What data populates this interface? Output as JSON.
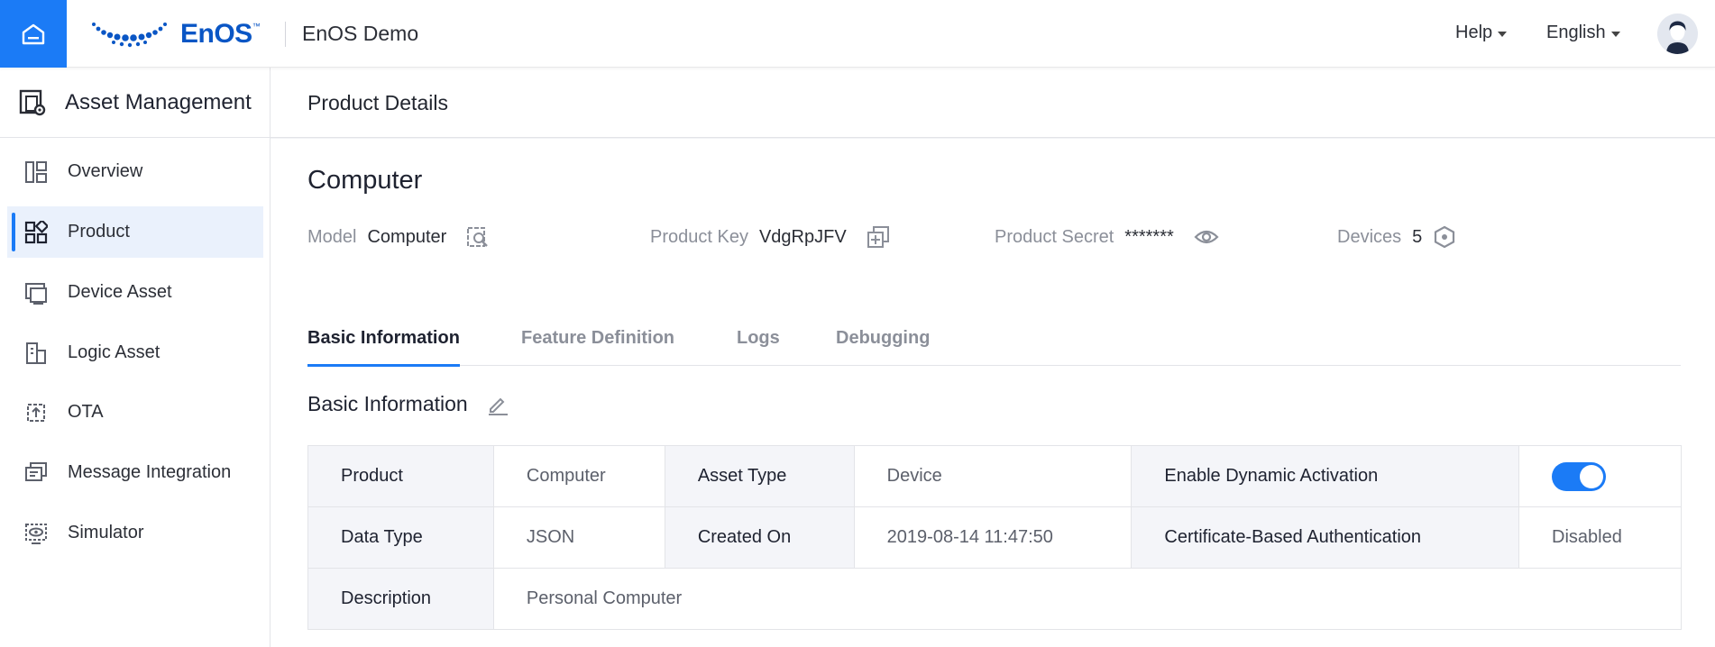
{
  "header": {
    "logo_text": "EnOS",
    "logo_tm": "™",
    "app_name": "EnOS Demo",
    "help_label": "Help",
    "language_label": "English"
  },
  "sidebar": {
    "title": "Asset Management",
    "items": [
      {
        "label": "Overview",
        "icon": "overview-icon",
        "active": false
      },
      {
        "label": "Product",
        "icon": "product-icon",
        "active": true
      },
      {
        "label": "Device Asset",
        "icon": "device-asset-icon",
        "active": false
      },
      {
        "label": "Logic Asset",
        "icon": "logic-asset-icon",
        "active": false
      },
      {
        "label": "OTA",
        "icon": "ota-icon",
        "active": false
      },
      {
        "label": "Message Integration",
        "icon": "message-integration-icon",
        "active": false
      },
      {
        "label": "Simulator",
        "icon": "simulator-icon",
        "active": false
      }
    ]
  },
  "page": {
    "breadcrumb": "Product Details",
    "product_name": "Computer",
    "meta": {
      "model_label": "Model",
      "model_value": "Computer",
      "key_label": "Product Key",
      "key_value": "VdgRpJFV",
      "secret_label": "Product Secret",
      "secret_value": "*******",
      "devices_label": "Devices",
      "devices_value": "5"
    },
    "tabs": [
      {
        "label": "Basic Information",
        "active": true
      },
      {
        "label": "Feature Definition",
        "active": false
      },
      {
        "label": "Logs",
        "active": false
      },
      {
        "label": "Debugging",
        "active": false
      }
    ],
    "section_title": "Basic Information",
    "table": {
      "product_label": "Product",
      "product_value": "Computer",
      "asset_type_label": "Asset Type",
      "asset_type_value": "Device",
      "dynamic_activation_label": "Enable Dynamic Activation",
      "dynamic_activation_on": true,
      "data_type_label": "Data Type",
      "data_type_value": "JSON",
      "created_on_label": "Created On",
      "created_on_value": "2019-08-14 11:47:50",
      "cert_auth_label": "Certificate-Based Authentication",
      "cert_auth_value": "Disabled",
      "description_label": "Description",
      "description_value": "Personal Computer"
    }
  },
  "colors": {
    "accent": "#1b7bf6",
    "brand": "#0a56c5",
    "active_bg": "#eaf1fc",
    "label_cell_bg": "#f4f5f9"
  }
}
